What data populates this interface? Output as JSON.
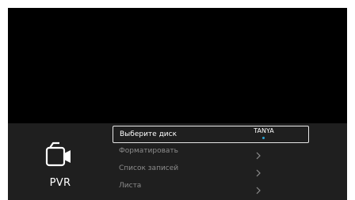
{
  "sidebar": {
    "icon": "video-camera-icon",
    "label": "PVR"
  },
  "menu": {
    "items": [
      {
        "label": "Выберите диск",
        "value": "TANYA",
        "selected": true
      },
      {
        "label": "Форматировать",
        "icon": "chevron-right-icon"
      },
      {
        "label": "Список записей",
        "icon": "chevron-right-icon"
      },
      {
        "label": "Листа",
        "icon": "chevron-right-icon"
      }
    ]
  },
  "colors": {
    "background": "#000000",
    "panel": "#1f1f1f",
    "selected_border": "#e6e6e6",
    "inactive_text": "#8c8c8c",
    "accent_dot": "#2aa6d8"
  }
}
